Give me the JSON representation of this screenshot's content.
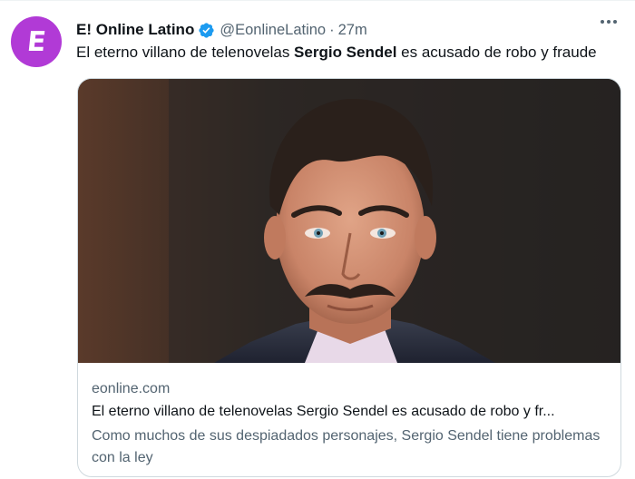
{
  "tweet": {
    "display_name": "E! Online Latino",
    "handle": "@EonlineLatino",
    "separator": "·",
    "time": "27m",
    "text_before": "El eterno villano de telenovelas ",
    "text_bold": "Sergio Sendel",
    "text_after": " es acusado de robo y fraude",
    "avatar_letter": "E",
    "avatar_color": "#b13ad6",
    "verified_icon": "verified-badge-icon",
    "more_icon": "more-options-icon"
  },
  "card": {
    "image_alt": "man-portrait-image",
    "domain": "eonline.com",
    "title": "El eterno villano de telenovelas Sergio Sendel es acusado de robo y fr...",
    "description": "Como muchos de sus despiadados personajes, Sergio Sendel tiene problemas con la ley"
  },
  "colors": {
    "text_primary": "#0f1419",
    "text_secondary": "#536471",
    "border": "#cfd9de",
    "verified_blue": "#1d9bf0"
  }
}
